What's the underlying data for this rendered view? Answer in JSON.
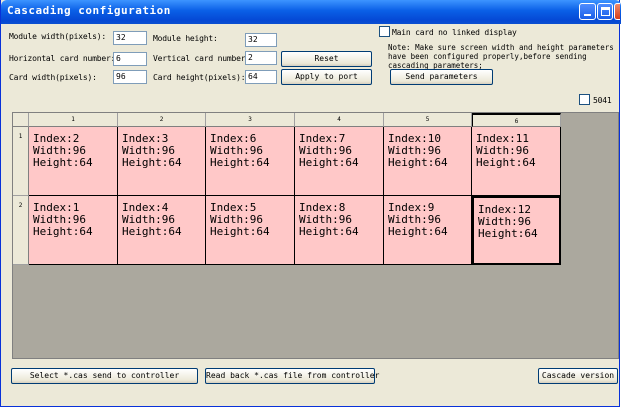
{
  "window": {
    "title": "Cascading configuration"
  },
  "form": {
    "module_width_label": "Module width(pixels):",
    "module_width_value": "32",
    "module_height_label": "Module height:",
    "module_height_value": "32",
    "horizontal_label": "Horizontal card number:",
    "horizontal_value": "6",
    "vertical_label": "Vertical card number:",
    "vertical_value": "2",
    "card_width_label": "Card width(pixels):",
    "card_width_value": "96",
    "card_height_label": "Card height(pixels):",
    "card_height_value": "64",
    "reset_label": "Reset",
    "apply_label": "Apply to port"
  },
  "options": {
    "main_card_label": "Main card no linked display",
    "main_card_checked": false,
    "note": "Note: Make sure screen width and height parameters have been configured properly,before sending cascading parameters;",
    "send_params_label": "Send parameters",
    "s5041_label": "5041",
    "s5041_checked": false
  },
  "grid": {
    "columns": [
      "1",
      "2",
      "3",
      "4",
      "5",
      "6"
    ],
    "rows": [
      {
        "label": "1",
        "cells": [
          {
            "index": "Index:2",
            "width": "Width:96",
            "height": "Height:64"
          },
          {
            "index": "Index:3",
            "width": "Width:96",
            "height": "Height:64"
          },
          {
            "index": "Index:6",
            "width": "Width:96",
            "height": "Height:64"
          },
          {
            "index": "Index:7",
            "width": "Width:96",
            "height": "Height:64"
          },
          {
            "index": "Index:10",
            "width": "Width:96",
            "height": "Height:64"
          },
          {
            "index": "Index:11",
            "width": "Width:96",
            "height": "Height:64"
          }
        ]
      },
      {
        "label": "2",
        "cells": [
          {
            "index": "Index:1",
            "width": "Width:96",
            "height": "Height:64"
          },
          {
            "index": "Index:4",
            "width": "Width:96",
            "height": "Height:64"
          },
          {
            "index": "Index:5",
            "width": "Width:96",
            "height": "Height:64"
          },
          {
            "index": "Index:8",
            "width": "Width:96",
            "height": "Height:64"
          },
          {
            "index": "Index:9",
            "width": "Width:96",
            "height": "Height:64"
          },
          {
            "index": "Index:12",
            "width": "Width:96",
            "height": "Height:64"
          }
        ]
      }
    ]
  },
  "footer": {
    "select_label": "Select *.cas send to controller",
    "readback_label": "Read back *.cas file from controller",
    "version_label": "Cascade version"
  },
  "colors": {
    "cell": "#ffc8c8",
    "title": "#0a5fe6",
    "face": "#ece9d8"
  },
  "icons": [
    "minimize-icon",
    "maximize-icon",
    "close-icon"
  ]
}
